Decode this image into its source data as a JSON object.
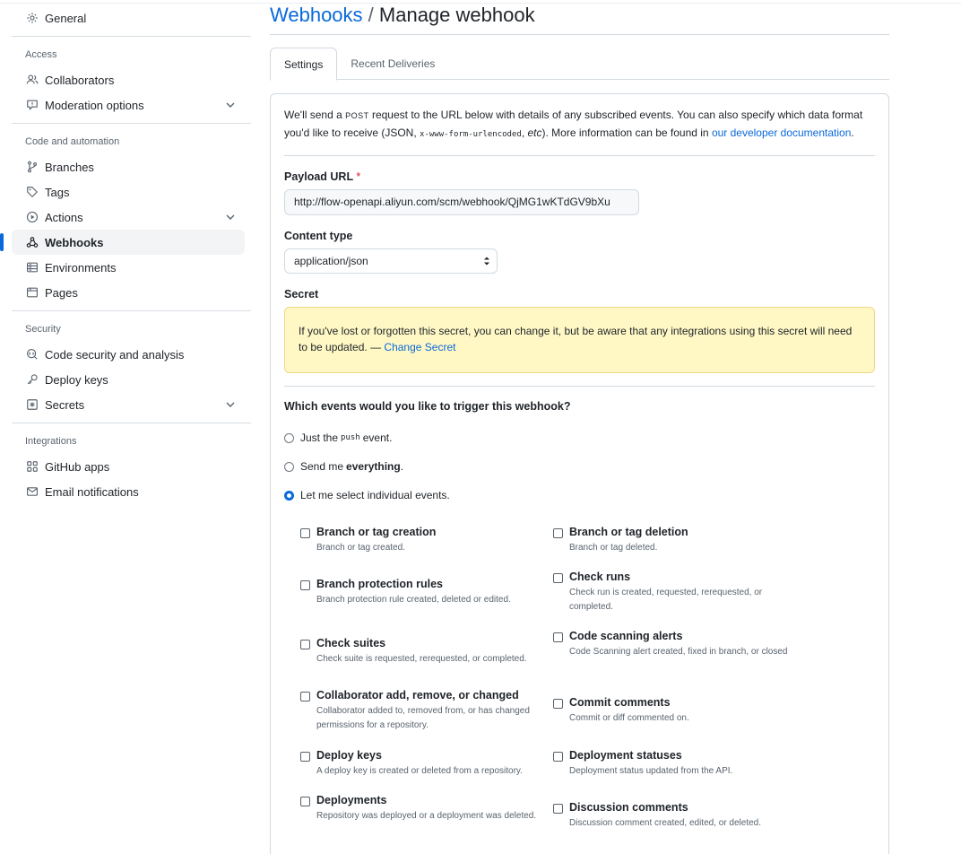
{
  "sidebar": {
    "general": "General",
    "access": {
      "title": "Access",
      "items": [
        "Collaborators",
        "Moderation options"
      ]
    },
    "code": {
      "title": "Code and automation",
      "items": [
        "Branches",
        "Tags",
        "Actions",
        "Webhooks",
        "Environments",
        "Pages"
      ]
    },
    "security": {
      "title": "Security",
      "items": [
        "Code security and analysis",
        "Deploy keys",
        "Secrets"
      ]
    },
    "integrations": {
      "title": "Integrations",
      "items": [
        "GitHub apps",
        "Email notifications"
      ]
    }
  },
  "header": {
    "breadcrumb": "Webhooks",
    "slash": " / ",
    "title": "Manage webhook"
  },
  "tabs": [
    "Settings",
    "Recent Deliveries"
  ],
  "intro": {
    "part1": "We'll send a ",
    "post": "POST",
    "part2": " request to the URL below with details of any subscribed events. You can also specify which data format you'd like to receive (JSON, ",
    "code": "x-www-form-urlencoded",
    "part3": ", ",
    "etc": "etc",
    "part4": "). More information can be found in ",
    "link": "our developer documentation",
    "part5": "."
  },
  "payload": {
    "label": "Payload URL",
    "required": "*",
    "value": "http://flow-openapi.aliyun.com/scm/webhook/QjMG1wKTdGV9bXu"
  },
  "content_type": {
    "label": "Content type",
    "value": "application/json"
  },
  "secret": {
    "label": "Secret",
    "message": "If you've lost or forgotten this secret, you can change it, but be aware that any integrations using this secret will need to be updated. — ",
    "link": "Change Secret"
  },
  "events_question": "Which events would you like to trigger this webhook?",
  "radios": {
    "push_pre": "Just the",
    "push_code": "push",
    "push_post": "event.",
    "all_pre": "Send me",
    "all_bold": "everything",
    "all_post": ".",
    "select": "Let me select individual events."
  },
  "events": [
    {
      "name": "Branch or tag creation",
      "desc": "Branch or tag created."
    },
    {
      "name": "Branch or tag deletion",
      "desc": "Branch or tag deleted."
    },
    {
      "name": "Branch protection rules",
      "desc": "Branch protection rule created, deleted or edited."
    },
    {
      "name": "Check runs",
      "desc": "Check run is created, requested, rerequested, or completed."
    },
    {
      "name": "Check suites",
      "desc": "Check suite is requested, rerequested, or completed."
    },
    {
      "name": "Code scanning alerts",
      "desc": "Code Scanning alert created, fixed in branch, or closed"
    },
    {
      "name": "Collaborator add, remove, or changed",
      "desc": "Collaborator added to, removed from, or has changed permissions for a repository."
    },
    {
      "name": "Commit comments",
      "desc": "Commit or diff commented on."
    },
    {
      "name": "Deploy keys",
      "desc": "A deploy key is created or deleted from a repository."
    },
    {
      "name": "Deployment statuses",
      "desc": "Deployment status updated from the API."
    },
    {
      "name": "Deployments",
      "desc": "Repository was deployed or a deployment was deleted."
    },
    {
      "name": "Discussion comments",
      "desc": "Discussion comment created, edited, or deleted."
    }
  ]
}
